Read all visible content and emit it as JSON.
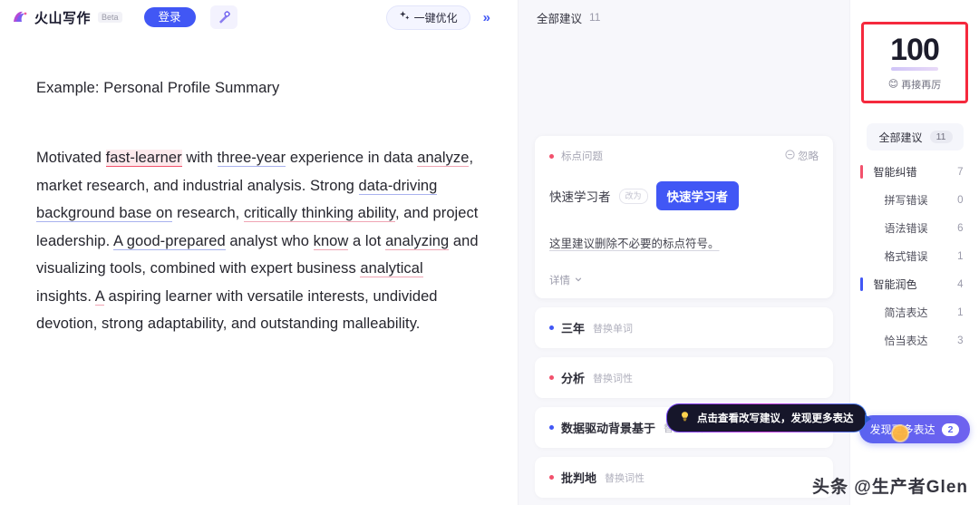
{
  "header": {
    "brand_name": "火山写作",
    "beta_tag": "Beta",
    "login_label": "登录",
    "magic_icon": "magic-wand-icon",
    "optimize_label": "一键优化",
    "optimize_icon": "sparkle-icon",
    "collapse_icon": "double-chevron-right-icon"
  },
  "editor": {
    "title": "Example: Personal Profile Summary",
    "paragraph": [
      {
        "t": "Motivated ",
        "style": "plain"
      },
      {
        "t": "fast-learner",
        "style": "error-red"
      },
      {
        "t": " with ",
        "style": "plain"
      },
      {
        "t": "three-year",
        "style": "underline-blue"
      },
      {
        "t": " experience in data ",
        "style": "plain"
      },
      {
        "t": "analyze",
        "style": "underline-red"
      },
      {
        "t": ", market research, and industrial analysis. Strong ",
        "style": "plain"
      },
      {
        "t": "data-driving background base on",
        "style": "underline-blue"
      },
      {
        "t": " research, ",
        "style": "plain"
      },
      {
        "t": "critically thinking ability",
        "style": "underline-red"
      },
      {
        "t": ", and project leadership. ",
        "style": "plain"
      },
      {
        "t": "A good-prepared",
        "style": "underline-blue"
      },
      {
        "t": " analyst who ",
        "style": "plain"
      },
      {
        "t": "know",
        "style": "underline-red"
      },
      {
        "t": " a lot ",
        "style": "plain"
      },
      {
        "t": "analyzing",
        "style": "underline-red"
      },
      {
        "t": " and visualizing tools, combined with expert business ",
        "style": "plain"
      },
      {
        "t": "analytical",
        "style": "underline-red"
      },
      {
        "t": " insights. ",
        "style": "plain"
      },
      {
        "t": "A",
        "style": "underline-red"
      },
      {
        "t": " aspiring learner with versatile interests, undivided devotion, strong adaptability, and outstanding malleability.",
        "style": "plain"
      }
    ]
  },
  "suggestions": {
    "header_label": "全部建议",
    "header_count": "11",
    "card": {
      "kind": "标点问题",
      "ignore_label": "忽略",
      "ignore_icon": "circle-minus-icon",
      "original": "快速学习者",
      "arrow_icon": "改为",
      "replacement": "快速学习者",
      "description": "这里建议删除不必要的标点符号。",
      "more_label": "详情",
      "more_icon": "chevron-down-icon"
    },
    "rows": [
      {
        "word": "三年",
        "tag": "替换单词",
        "dot": "blue"
      },
      {
        "word": "分析",
        "tag": "替换词性",
        "dot": "red"
      },
      {
        "word": "数据驱动背景基于",
        "tag": "替换短语",
        "dot": "blue"
      },
      {
        "word": "批判地",
        "tag": "替换词性",
        "dot": "red"
      }
    ],
    "tooltip": {
      "icon": "lightbulb-icon",
      "text": "点击查看改写建议，发现更多表达"
    }
  },
  "sidebar": {
    "score": "100",
    "score_label": "再接再厉",
    "score_emoji": "😊",
    "categories": [
      {
        "name": "全部建议",
        "count": "11",
        "level": "all",
        "bar": ""
      },
      {
        "name": "智能纠错",
        "count": "7",
        "level": "head",
        "bar": "#f2516c"
      },
      {
        "name": "拼写错误",
        "count": "0",
        "level": "sub",
        "bar": ""
      },
      {
        "name": "语法错误",
        "count": "6",
        "level": "sub",
        "bar": ""
      },
      {
        "name": "格式错误",
        "count": "1",
        "level": "sub",
        "bar": ""
      },
      {
        "name": "智能润色",
        "count": "4",
        "level": "head",
        "bar": "#4157f5"
      },
      {
        "name": "简洁表达",
        "count": "1",
        "level": "sub",
        "bar": ""
      },
      {
        "name": "恰当表达",
        "count": "3",
        "level": "sub",
        "bar": ""
      }
    ],
    "discover_label": "发现更多表达",
    "discover_badge": "2",
    "discover_icon": "sparkle-icon",
    "cursor_icon": "mouse-pointer-icon"
  },
  "watermark": "头条 @生产者Glen",
  "colors": {
    "primary": "#4157f5",
    "error": "#f2516c",
    "highlight_box": "#f5293d",
    "panel_bg": "#f7f7fb"
  }
}
